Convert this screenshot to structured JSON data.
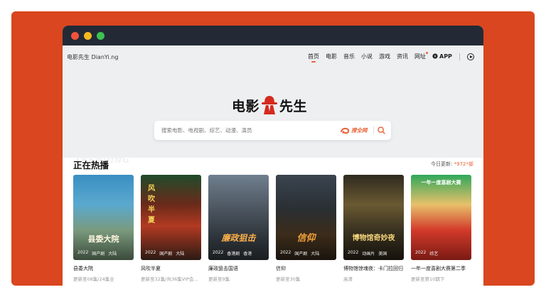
{
  "header": {
    "brand": "电影先生 DianYi.ng",
    "nav": [
      {
        "label": "首页",
        "active": true
      },
      {
        "label": "电影"
      },
      {
        "label": "音乐"
      },
      {
        "label": "小说"
      },
      {
        "label": "游戏"
      },
      {
        "label": "资讯"
      },
      {
        "label": "网址",
        "dot": true
      }
    ],
    "app_label": "APP",
    "icons": {
      "app": "bolt-icon",
      "history": "play-circle-icon"
    }
  },
  "logo": {
    "text_left": "电影",
    "text_right": "先生",
    "mark": "hat-logo-icon"
  },
  "search": {
    "placeholder": "搜索电影、电视剧、综艺、动漫、演员",
    "search_all_label": "搜全网",
    "icons": {
      "search_all": "swirl-icon",
      "search": "search-icon"
    }
  },
  "section": {
    "title": "正在热播",
    "watermark": "TRENDING",
    "update_prefix": "今日更新: ",
    "update_count": "*972*部"
  },
  "cards": [
    {
      "title": "县委大院",
      "sub": "更新至08集/24集全",
      "year": "2022",
      "region": "国产剧",
      "area": "大陆",
      "poster_text": "县委大院"
    },
    {
      "title": "风吹半夏",
      "sub": "更新至32集/共36集VIP会...",
      "year": "2022",
      "region": "国产剧",
      "area": "大陆",
      "poster_text": "风吹半夏"
    },
    {
      "title": "廉政狙击国语",
      "sub": "更新至9集",
      "year": "2022",
      "region": "香港剧",
      "area": "香港",
      "poster_text": "廉政狙击"
    },
    {
      "title": "信仰",
      "sub": "更新至30集",
      "year": "2022",
      "region": "国产剧",
      "area": "大陆",
      "poster_text": "信仰"
    },
    {
      "title": "博物馆惊魂夜：卡门拉回归",
      "sub": "高清",
      "year": "2022",
      "region": "动画片",
      "area": "美国",
      "poster_text": "博物馆奇妙夜"
    },
    {
      "title": "一年一度喜剧大赛第二季",
      "sub": "更新至第10期下",
      "year": "2022",
      "region": "综艺",
      "area": "",
      "poster_text": "一年一度喜剧大赛"
    }
  ],
  "colors": {
    "frame": "#d9461f",
    "accent": "#e8643a",
    "titlebar": "#232a36"
  }
}
